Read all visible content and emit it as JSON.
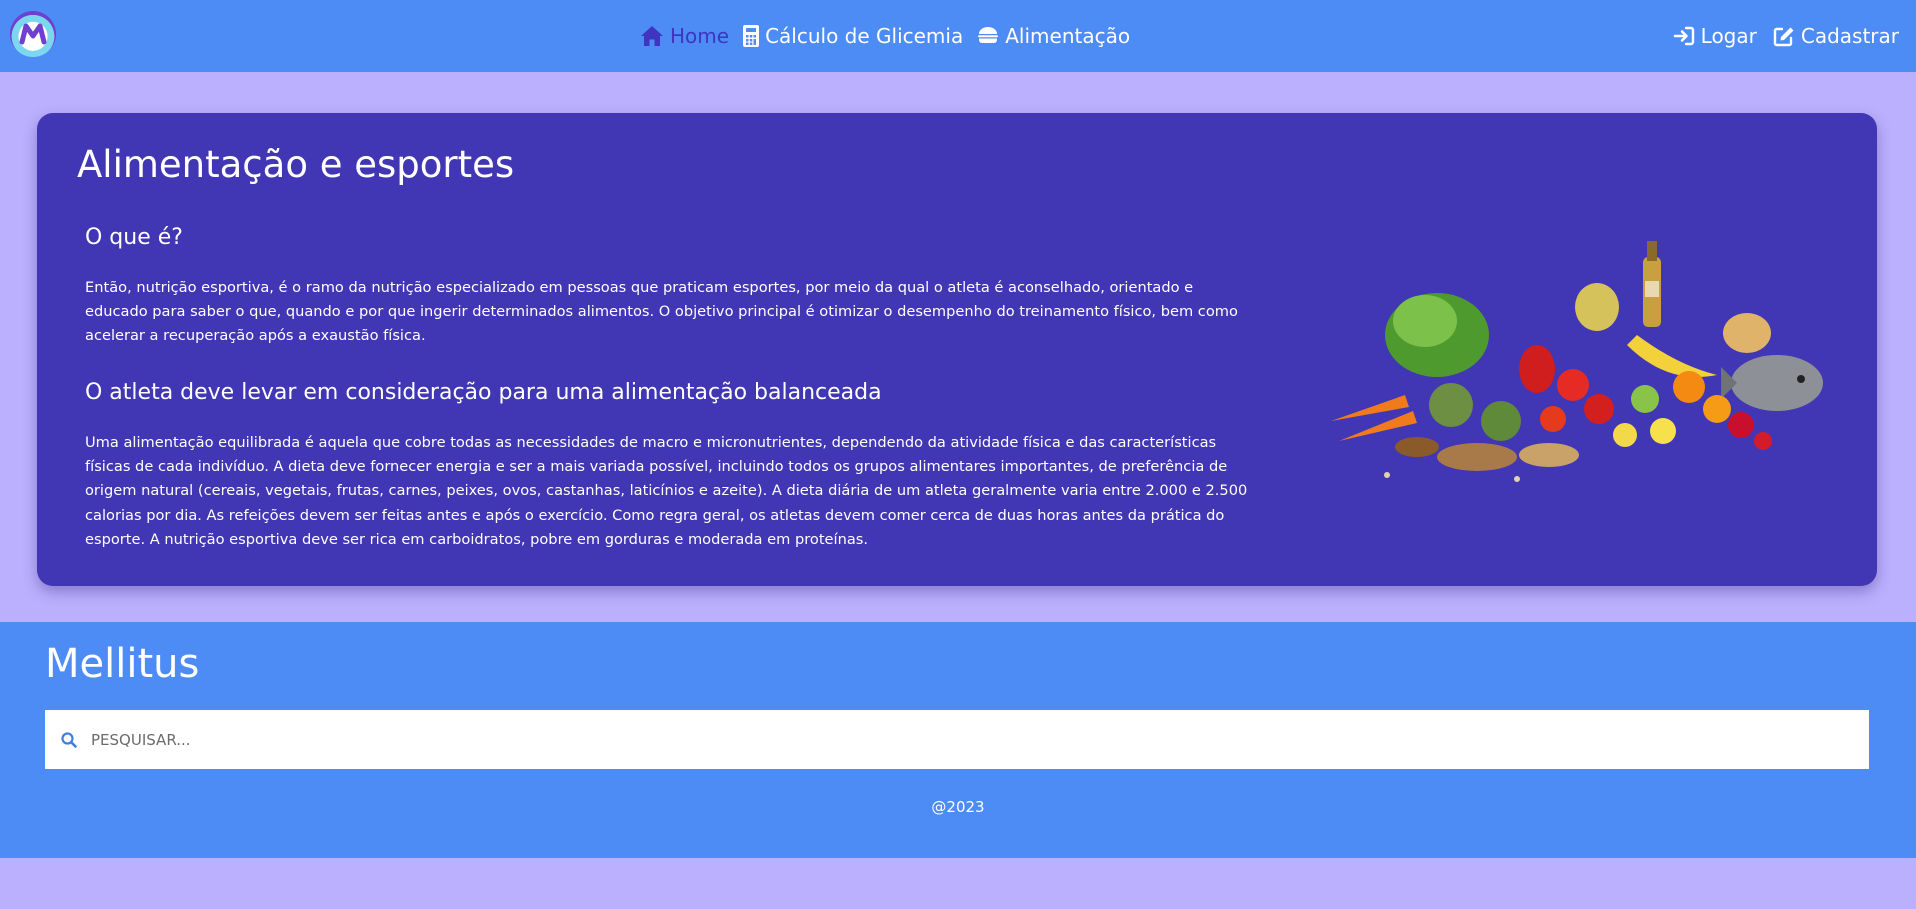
{
  "nav": {
    "links": [
      {
        "label": "Home",
        "icon": "home-icon",
        "active": true
      },
      {
        "label": "Cálculo de Glicemia",
        "icon": "calculator-icon"
      },
      {
        "label": "Alimentação",
        "icon": "food-bowl-icon"
      }
    ],
    "auth": [
      {
        "label": "Logar",
        "icon": "sign-in-icon"
      },
      {
        "label": "Cadastrar",
        "icon": "edit-icon"
      }
    ]
  },
  "article": {
    "title": "Alimentação e esportes",
    "sections": [
      {
        "heading": "O que é?",
        "text": "Então, nutrição esportiva, é o ramo da nutrição especializado em pessoas que praticam esportes, por meio da qual o atleta é aconselhado, orientado e educado para saber o que, quando e por que ingerir determinados alimentos. O objetivo principal é otimizar o desempenho do treinamento físico, bem como acelerar a recuperação após a exaustão física."
      },
      {
        "heading": "O atleta deve levar em consideração para uma alimentação balanceada",
        "text": "Uma alimentação equilibrada é aquela que cobre todas as necessidades de macro e micronutrientes, dependendo da atividade física e das características físicas de cada indivíduo. A dieta deve fornecer energia e ser a mais variada possível, incluindo todos os grupos alimentares importantes, de preferência de origem natural (cereais, vegetais, frutas, carnes, peixes, ovos, castanhas, laticínios e azeite). A dieta diária de um atleta geralmente varia entre 2.000 e 2.500 calorias por dia. As refeições devem ser feitas antes e após o exercício. Como regra geral, os atletas devem comer cerca de duas horas antes da prática do esporte. A nutrição esportiva deve ser rica em carboidratos, pobre em gorduras e moderada em proteínas."
      }
    ]
  },
  "footer": {
    "brand": "Mellitus",
    "search_placeholder": "PESQUISAR...",
    "copyright": "@2023"
  },
  "colors": {
    "navbar": "#4d8cf5",
    "page_background": "#bbb0fd",
    "card": "#4136b3",
    "active_link": "#3f35c0"
  }
}
